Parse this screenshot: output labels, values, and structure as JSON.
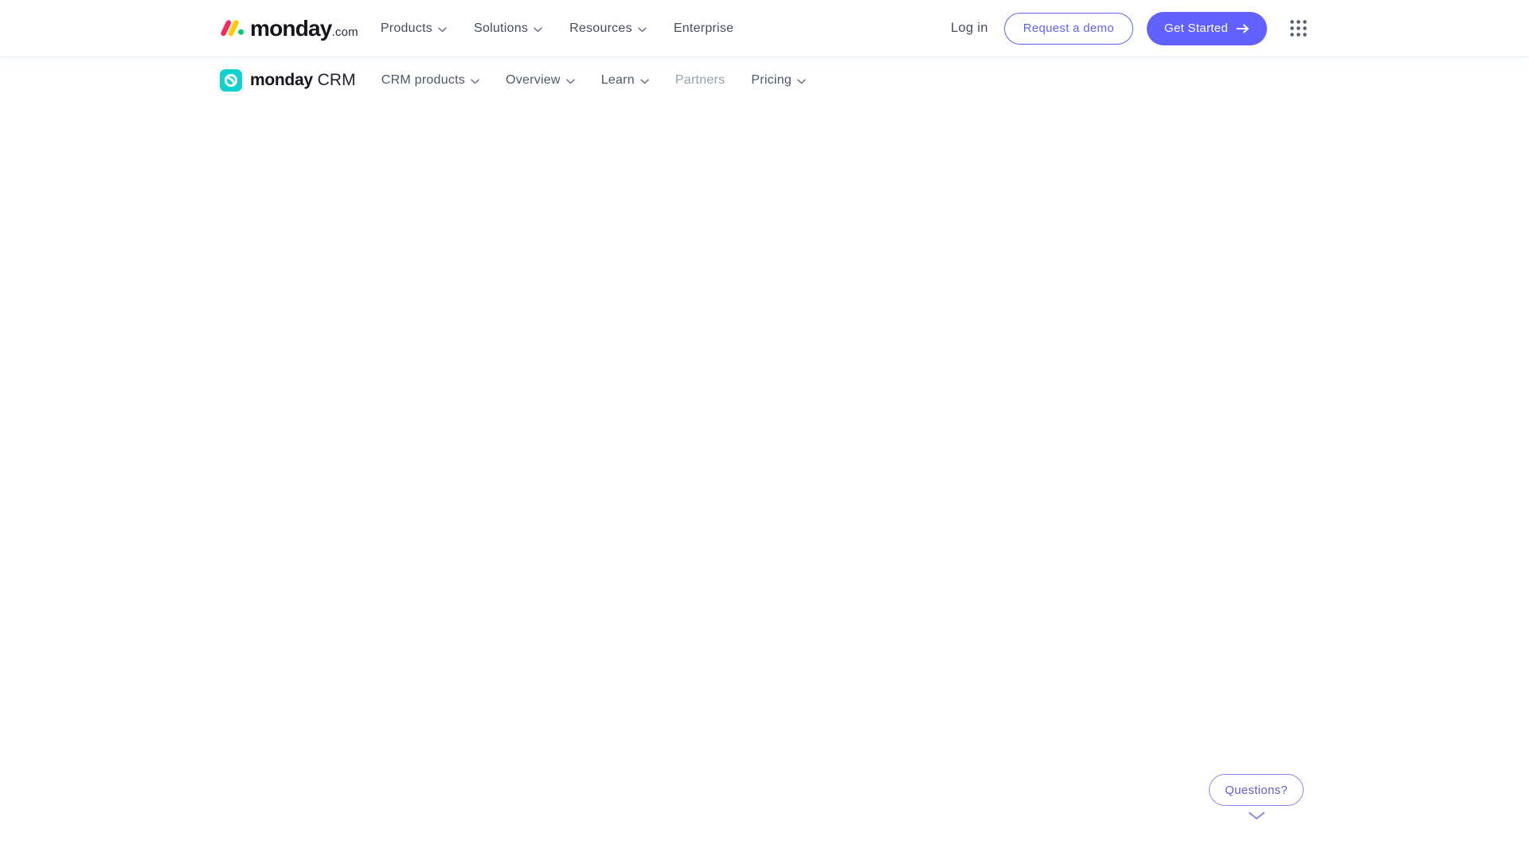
{
  "brand": {
    "name": "monday",
    "tld": ".com",
    "colors": {
      "logo_red": "#fb275d",
      "logo_yellow": "#ffcb00",
      "logo_green": "#00ca72",
      "accent_purple": "#6161ff",
      "crm_teal": "#00d2d2",
      "nav_text": "#474b60",
      "muted_nav_text": "#9a9fae",
      "header_border": "#e6eef6"
    }
  },
  "icons": {
    "monday_logo_mark": "two slanted bars + dot",
    "dropdown": "chevron-down",
    "get_started_arrow": "arrow-right",
    "apps_grid": "3x3-dots",
    "crm_logo": "teal rounded square with white loop",
    "chat_collapse": "chevron-down"
  },
  "top_nav": {
    "items": [
      {
        "label": "Products",
        "has_dropdown": true
      },
      {
        "label": "Solutions",
        "has_dropdown": true
      },
      {
        "label": "Resources",
        "has_dropdown": true
      },
      {
        "label": "Enterprise",
        "has_dropdown": false
      }
    ],
    "login_label": "Log in",
    "request_demo_label": "Request a demo",
    "get_started_label": "Get Started"
  },
  "crm_nav": {
    "brand_bold": "monday",
    "brand_suffix": " CRM",
    "items": [
      {
        "label": "CRM products",
        "has_dropdown": true
      },
      {
        "label": "Overview",
        "has_dropdown": true
      },
      {
        "label": "Learn",
        "has_dropdown": true
      },
      {
        "label": "Partners",
        "has_dropdown": false,
        "muted": true
      },
      {
        "label": "Pricing",
        "has_dropdown": true
      }
    ]
  },
  "chat_widget": {
    "label": "Questions?"
  }
}
